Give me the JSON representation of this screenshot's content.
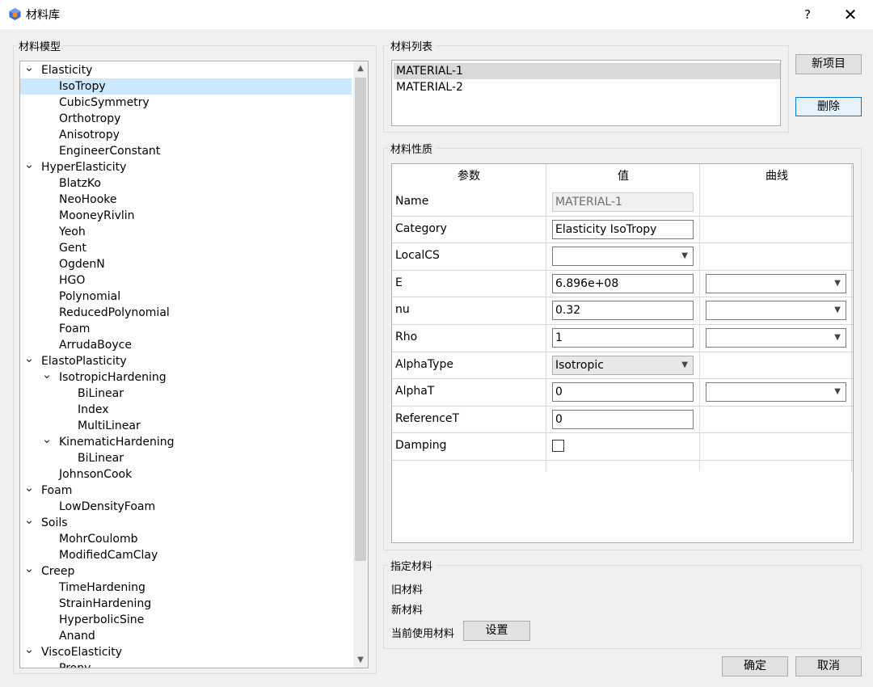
{
  "window": {
    "title": "材料库",
    "help": "?",
    "close": "✕"
  },
  "model_group": {
    "title": "材料模型"
  },
  "tree": [
    {
      "label": "Elasticity",
      "level": 0,
      "expanded": true
    },
    {
      "label": "IsoTropy",
      "level": 1,
      "selected": true
    },
    {
      "label": "CubicSymmetry",
      "level": 1
    },
    {
      "label": "Orthotropy",
      "level": 1
    },
    {
      "label": "Anisotropy",
      "level": 1
    },
    {
      "label": "EngineerConstant",
      "level": 1
    },
    {
      "label": "HyperElasticity",
      "level": 0,
      "expanded": true
    },
    {
      "label": "BlatzKo",
      "level": 1
    },
    {
      "label": "NeoHooke",
      "level": 1
    },
    {
      "label": "MooneyRivlin",
      "level": 1
    },
    {
      "label": "Yeoh",
      "level": 1
    },
    {
      "label": "Gent",
      "level": 1
    },
    {
      "label": "OgdenN",
      "level": 1
    },
    {
      "label": "HGO",
      "level": 1
    },
    {
      "label": "Polynomial",
      "level": 1
    },
    {
      "label": "ReducedPolynomial",
      "level": 1
    },
    {
      "label": "Foam",
      "level": 1
    },
    {
      "label": "ArrudaBoyce",
      "level": 1
    },
    {
      "label": "ElastoPlasticity",
      "level": 0,
      "expanded": true
    },
    {
      "label": "IsotropicHardening",
      "level": 1,
      "expanded": true
    },
    {
      "label": "BiLinear",
      "level": 2
    },
    {
      "label": "Index",
      "level": 2
    },
    {
      "label": "MultiLinear",
      "level": 2
    },
    {
      "label": "KinematicHardening",
      "level": 1,
      "expanded": true
    },
    {
      "label": "BiLinear",
      "level": 2
    },
    {
      "label": "JohnsonCook",
      "level": 1
    },
    {
      "label": "Foam",
      "level": 0,
      "expanded": true
    },
    {
      "label": "LowDensityFoam",
      "level": 1
    },
    {
      "label": "Soils",
      "level": 0,
      "expanded": true
    },
    {
      "label": "MohrCoulomb",
      "level": 1
    },
    {
      "label": "ModifiedCamClay",
      "level": 1
    },
    {
      "label": "Creep",
      "level": 0,
      "expanded": true
    },
    {
      "label": "TimeHardening",
      "level": 1
    },
    {
      "label": "StrainHardening",
      "level": 1
    },
    {
      "label": "HyperbolicSine",
      "level": 1
    },
    {
      "label": "Anand",
      "level": 1
    },
    {
      "label": "ViscoElasticity",
      "level": 0,
      "expanded": true
    },
    {
      "label": "Prony",
      "level": 1
    }
  ],
  "list_group": {
    "title": "材料列表"
  },
  "materials": [
    {
      "label": "MATERIAL-1",
      "selected": true
    },
    {
      "label": "MATERIAL-2",
      "selected": false
    }
  ],
  "buttons": {
    "new": "新项目",
    "delete": "删除",
    "set": "设置",
    "ok": "确定",
    "cancel": "取消"
  },
  "props_group": {
    "title": "材料性质"
  },
  "props_table": {
    "headers": [
      "参数",
      "值",
      "曲线"
    ],
    "rows": [
      {
        "name": "Name",
        "value": "MATERIAL-1",
        "kind": "text-disabled",
        "curve": false
      },
      {
        "name": "Category",
        "value": "Elasticity IsoTropy",
        "kind": "text",
        "curve": false
      },
      {
        "name": "LocalCS",
        "value": "",
        "kind": "combo",
        "curve": false
      },
      {
        "name": "E",
        "value": "6.896e+08",
        "kind": "text",
        "curve": true
      },
      {
        "name": "nu",
        "value": "0.32",
        "kind": "text",
        "curve": true
      },
      {
        "name": "Rho",
        "value": "1",
        "kind": "text",
        "curve": true
      },
      {
        "name": "AlphaType",
        "value": "Isotropic",
        "kind": "combo-gray",
        "curve": false
      },
      {
        "name": "AlphaT",
        "value": "0",
        "kind": "text",
        "curve": true
      },
      {
        "name": "ReferenceT",
        "value": "0",
        "kind": "text",
        "curve": false
      },
      {
        "name": "Damping",
        "value": "",
        "kind": "checkbox",
        "curve": false
      }
    ]
  },
  "assign_group": {
    "title": "指定材料",
    "old_label": "旧材料",
    "new_label": "新材料",
    "current_label": "当前使用材料"
  },
  "colors": {
    "selection": "#cce8ff",
    "focus_border": "#0078d7",
    "list_selection": "#d9d9d9"
  },
  "icons": {
    "app": "material-library-icon",
    "expand": "chevron-down-icon",
    "scroll_up": "chevron-up-icon",
    "scroll_down": "chevron-down-icon",
    "combo": "chevron-down-icon"
  }
}
